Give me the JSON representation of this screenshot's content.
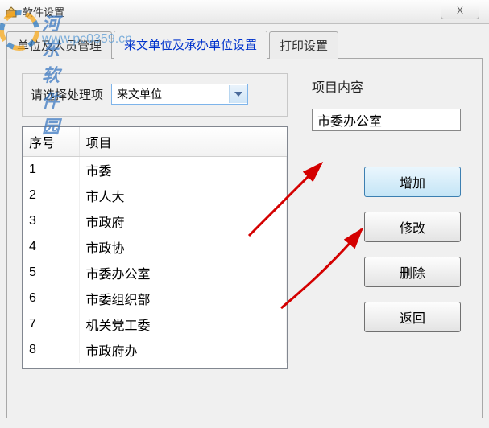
{
  "watermark": {
    "brand": "河东软件园",
    "url": "www.pc0359.cn"
  },
  "titlebar": {
    "title": "软件设置",
    "close": "X"
  },
  "tabs": [
    {
      "label": "单位及人员管理",
      "active": false
    },
    {
      "label": "来文单位及承办单位设置",
      "active": true
    },
    {
      "label": "打印设置",
      "active": false
    }
  ],
  "selector": {
    "label": "请选择处理项",
    "value": "来文单位"
  },
  "table": {
    "headers": {
      "seq": "序号",
      "item": "项目"
    },
    "rows": [
      {
        "seq": "1",
        "item": "市委"
      },
      {
        "seq": "2",
        "item": "市人大"
      },
      {
        "seq": "3",
        "item": "市政府"
      },
      {
        "seq": "4",
        "item": "市政协"
      },
      {
        "seq": "5",
        "item": "市委办公室"
      },
      {
        "seq": "6",
        "item": "市委组织部"
      },
      {
        "seq": "7",
        "item": "机关党工委"
      },
      {
        "seq": "8",
        "item": "市政府办"
      }
    ]
  },
  "right": {
    "field_label": "项目内容",
    "field_value": "市委办公室",
    "buttons": {
      "add": "增加",
      "edit": "修改",
      "delete": "删除",
      "back": "返回"
    }
  }
}
